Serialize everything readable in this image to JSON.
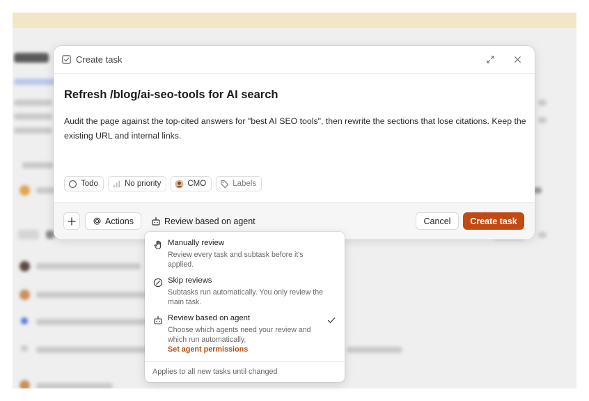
{
  "modal": {
    "header_title": "Create task",
    "task_title": "Refresh /blog/ai-seo-tools for AI search",
    "description": "Audit the page against the top-cited answers for \"best AI SEO tools\", then rewrite the sections that lose citations. Keep the existing URL and internal links.",
    "chips": {
      "status": "Todo",
      "priority": "No priority",
      "assignee": "CMO",
      "labels": "Labels"
    }
  },
  "footer": {
    "actions_label": "Actions",
    "review_label": "Review based on agent",
    "cancel_label": "Cancel",
    "create_label": "Create task"
  },
  "review_menu": {
    "options": [
      {
        "title": "Manually review",
        "description": "Review every task and subtask before it's applied.",
        "icon": "hand-icon"
      },
      {
        "title": "Skip reviews",
        "description": "Subtasks run automatically. You only review the main task.",
        "icon": "skip-circle-icon"
      },
      {
        "title": "Review based on agent",
        "description": "Choose which agents need your review and which run automatically.",
        "link": "Set agent permissions",
        "icon": "robot-icon",
        "selected": true
      }
    ],
    "footer_note": "Applies to all new tasks until changed"
  },
  "colors": {
    "accent": "#c14a12",
    "link": "#b5500f",
    "banner": "#f2e6c8"
  }
}
